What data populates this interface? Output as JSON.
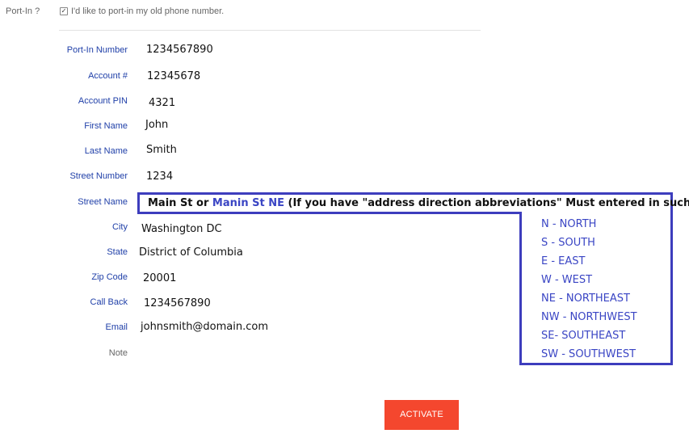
{
  "port_in": {
    "label": "Port-In ?",
    "checkbox_checked": true,
    "checkbox_text": "I'd like to port-in my old phone number."
  },
  "fields": [
    {
      "label": "Port-In Number",
      "value": "1234567890"
    },
    {
      "label": "Account #",
      "value": "12345678"
    },
    {
      "label": "Account PIN",
      "value": "4321"
    },
    {
      "label": "First Name",
      "value": "John"
    },
    {
      "label": "Last Name",
      "value": "Smith"
    },
    {
      "label": "Street Number",
      "value": "1234"
    },
    {
      "label": "Street Name",
      "value": ""
    },
    {
      "label": "City",
      "value": "Washington DC"
    },
    {
      "label": "State",
      "value": "District of Columbia"
    },
    {
      "label": "Zip Code",
      "value": "20001"
    },
    {
      "label": "Call Back",
      "value": "1234567890"
    },
    {
      "label": "Email",
      "value": "johnsmith@domain.com"
    },
    {
      "label": "Note",
      "value": ""
    }
  ],
  "street_annotation": {
    "part1": "Main St or ",
    "part2": "Manin St NE",
    "part3": " (If you have \"address direction abbreviations\" Must entered in such as",
    "directions": [
      "N - NORTH",
      "S - SOUTH",
      "E - EAST",
      "W - WEST",
      "NE - NORTHEAST",
      "NW - NORTHWEST",
      "SE- SOUTHEAST",
      "SW - SOUTHWEST"
    ],
    "color": "#3d3dbd"
  },
  "activate_button": {
    "label": "ACTIVATE",
    "color": "#f4472e"
  }
}
